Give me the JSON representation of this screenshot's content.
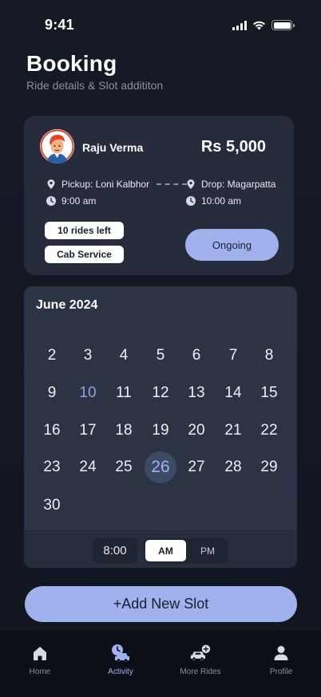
{
  "status_bar": {
    "time": "9:41"
  },
  "header": {
    "title": "Booking",
    "subtitle": "Ride details & Slot addititon"
  },
  "ride": {
    "driver_name": "Raju Verma",
    "price": "Rs 5,000",
    "pickup": "Pickup: Loni Kalbhor",
    "pickup_time": "9:00 am",
    "drop": "Drop: Magarpatta",
    "drop_time": "10:00 am",
    "rides_left": "10 rides left",
    "service": "Cab Service",
    "status": "Ongoing"
  },
  "calendar": {
    "month": "June 2024",
    "weeks": [
      [
        "2",
        "3",
        "4",
        "5",
        "6",
        "7",
        "8"
      ],
      [
        "9",
        "10",
        "11",
        "12",
        "13",
        "14",
        "15"
      ],
      [
        "16",
        "17",
        "18",
        "19",
        "20",
        "21",
        "22"
      ],
      [
        "23",
        "24",
        "25",
        "26",
        "27",
        "28",
        "29"
      ],
      [
        "30"
      ]
    ],
    "today": "10",
    "selected": "26",
    "time": "8:00",
    "am_label": "AM",
    "pm_label": "PM",
    "period_selected": "AM"
  },
  "actions": {
    "add_slot": "+Add New Slot"
  },
  "nav": {
    "items": [
      {
        "label": "Home",
        "icon": "home-icon"
      },
      {
        "label": "Activity",
        "icon": "activity-icon"
      },
      {
        "label": "More Rides",
        "icon": "car-add-icon"
      },
      {
        "label": "Profile",
        "icon": "profile-icon"
      }
    ],
    "active": "Activity"
  },
  "colors": {
    "background": "#151a25",
    "card": "#262c3b",
    "calendar": "#2b3345",
    "accent": "#9fb2ee",
    "nav_background": "#0c0f16"
  }
}
